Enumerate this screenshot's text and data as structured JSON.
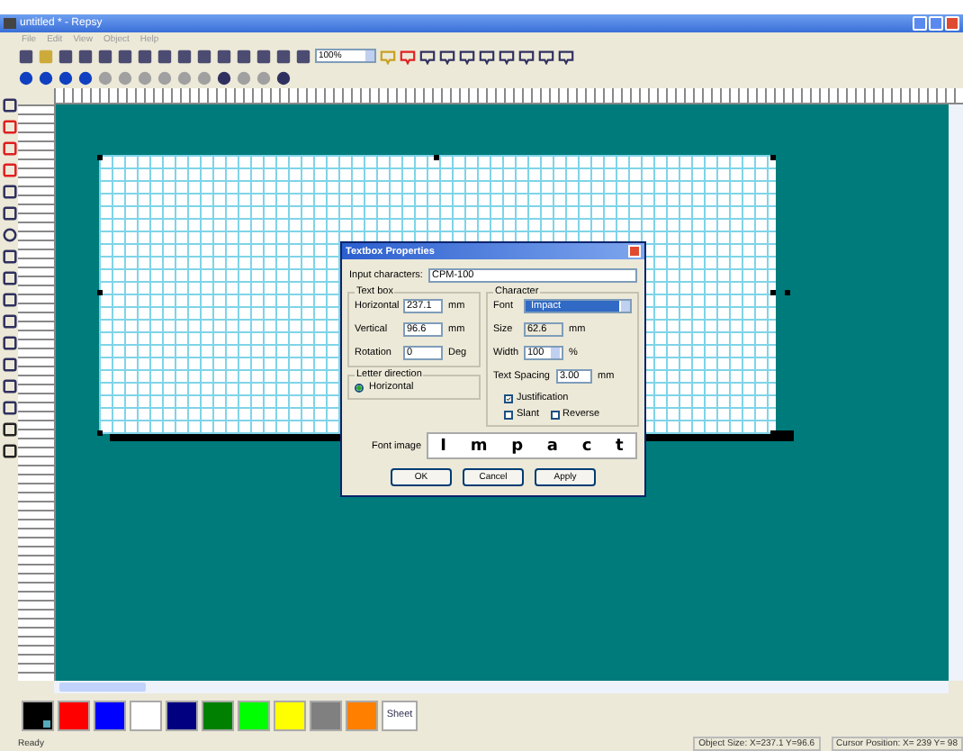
{
  "window": {
    "title": "untitled * - Repsy"
  },
  "menu": [
    "File",
    "Edit",
    "View",
    "Object",
    "Help"
  ],
  "toolbar": {
    "zoom": "100%"
  },
  "dialog": {
    "title": "Textbox Properties",
    "input_label": "Input characters:",
    "input_value": "CPM-100",
    "textbox_group": "Text box",
    "textbox_fields": [
      {
        "label": "Horizontal",
        "value": "237.1",
        "unit": "mm"
      },
      {
        "label": "Vertical",
        "value": "96.6",
        "unit": "mm"
      },
      {
        "label": "Rotation",
        "value": "0",
        "unit": "Deg"
      }
    ],
    "direction_group": "Letter direction",
    "direction_options": [
      {
        "label": "Horizontal",
        "selected": true
      }
    ],
    "character_group": "Character",
    "font_label": "Font",
    "font_value": "Impact",
    "size_label": "Size",
    "size_value": "62.6",
    "size_unit": "mm",
    "width_label": "Width",
    "width_value": "100",
    "width_unit": "%",
    "spacing_label": "Text Spacing",
    "spacing_value": "3.00",
    "spacing_unit": "mm",
    "checkboxes": [
      {
        "label": "Justification",
        "checked": true
      },
      {
        "label": "Slant",
        "checked": false
      },
      {
        "label": "Reverse",
        "checked": false
      }
    ],
    "image_label": "Font image",
    "image_letters": [
      "I",
      "m",
      "p",
      "a",
      "c",
      "t"
    ],
    "buttons": [
      "OK",
      "Cancel",
      "Apply"
    ]
  },
  "palette": [
    {
      "color": "#000000",
      "selected": true
    },
    {
      "color": "#ff0000",
      "selected": false
    },
    {
      "color": "#0000ff",
      "selected": false
    },
    {
      "color": "#ffffff",
      "selected": false
    },
    {
      "color": "#000080",
      "selected": false
    },
    {
      "color": "#008000",
      "selected": false
    },
    {
      "color": "#00ff00",
      "selected": false
    },
    {
      "color": "#ffff00",
      "selected": false
    },
    {
      "color": "#808080",
      "selected": false
    },
    {
      "color": "#ff8000",
      "selected": false
    }
  ],
  "sheet_button": "Sheet",
  "status_bar": {
    "message": "Ready",
    "object_size": "Object Size: X=237.1 Y=96.6",
    "cursor": "Cursor Position: X= 239 Y= 98"
  }
}
